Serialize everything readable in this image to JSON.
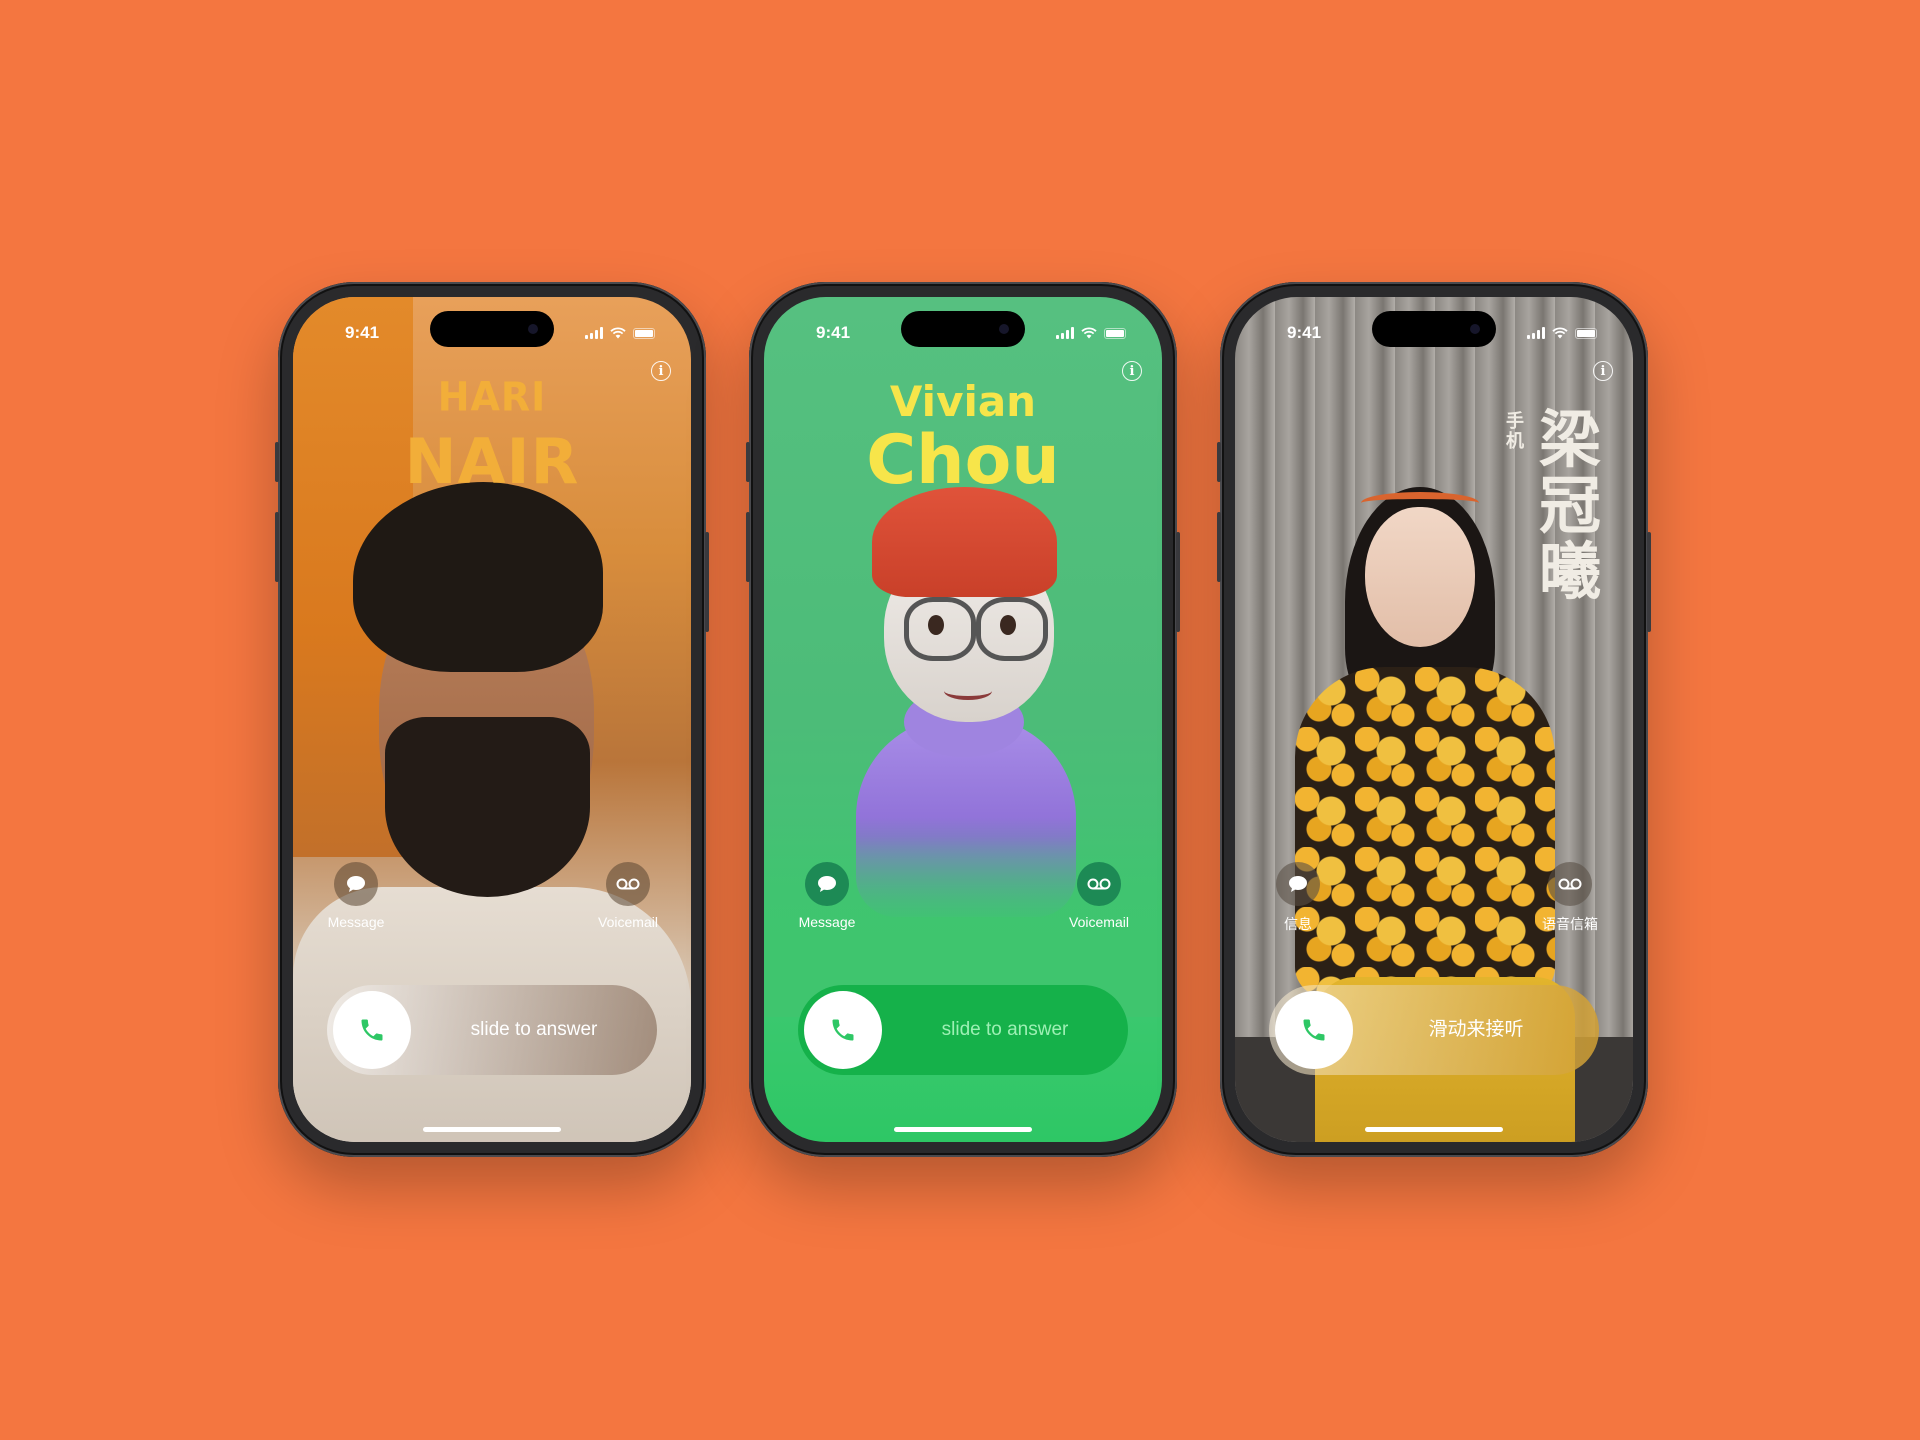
{
  "colors": {
    "background": "#f47640",
    "hari_name": "#f2ae39",
    "vivian_name": "#f7e54a",
    "answer_green": "#2ec765"
  },
  "phones": [
    {
      "time": "9:41",
      "name_line1": "HARI",
      "name_line2": "NAIR",
      "message_label": "Message",
      "voicemail_label": "Voicemail",
      "slide_label": "slide to answer",
      "info_icon": "info-icon"
    },
    {
      "time": "9:41",
      "name_line1": "Vivian",
      "name_line2": "Chou",
      "message_label": "Message",
      "voicemail_label": "Voicemail",
      "slide_label": "slide to answer",
      "info_icon": "info-icon"
    },
    {
      "time": "9:41",
      "name_vertical": "梁冠曦",
      "subtitle_vertical": "手机",
      "message_label": "信息",
      "voicemail_label": "语音信箱",
      "slide_label": "滑动来接听",
      "info_icon": "info-icon"
    }
  ]
}
